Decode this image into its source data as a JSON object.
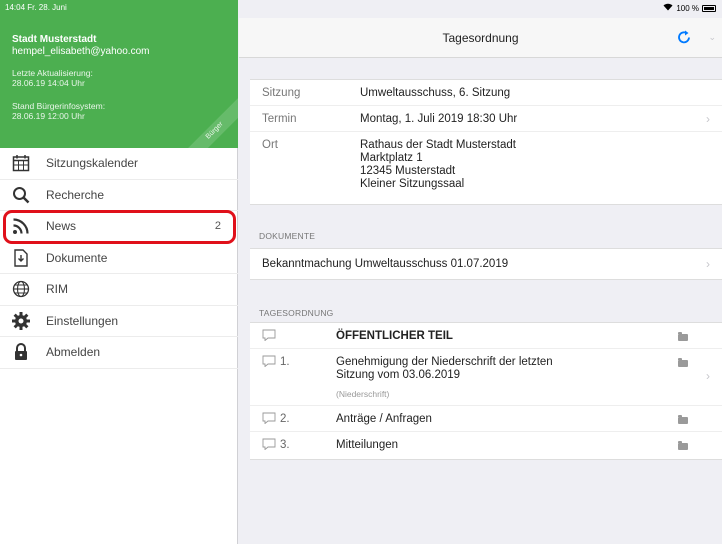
{
  "status_bar": {
    "time_date": "14:04  Fr. 28. Juni",
    "battery": "100 %"
  },
  "sidebar": {
    "city": "Stadt Musterstadt",
    "email": "hempel_elisabeth@yahoo.com",
    "last_update_label": "Letzte Aktualisierung:",
    "last_update_value": "28.06.19 14:04 Uhr",
    "system_label": "Stand Bürgerinfosystem:",
    "system_value": "28.06.19 12:00 Uhr",
    "ribbon": "Bürger",
    "items": [
      {
        "label": "Sitzungskalender",
        "icon": "calendar-icon",
        "count": ""
      },
      {
        "label": "Recherche",
        "icon": "search-icon",
        "count": ""
      },
      {
        "label": "News",
        "icon": "rss-icon",
        "count": "2"
      },
      {
        "label": "Dokumente",
        "icon": "document-icon",
        "count": ""
      },
      {
        "label": "RIM",
        "icon": "globe-icon",
        "count": ""
      },
      {
        "label": "Einstellungen",
        "icon": "gear-icon",
        "count": ""
      },
      {
        "label": "Abmelden",
        "icon": "lock-icon",
        "count": ""
      }
    ]
  },
  "nav": {
    "title": "Tagesordnung"
  },
  "meeting": {
    "sitzung_label": "Sitzung",
    "sitzung_value": "Umweltausschuss, 6. Sitzung",
    "termin_label": "Termin",
    "termin_value": "Montag, 1. Juli 2019 18:30 Uhr",
    "ort_label": "Ort",
    "ort_lines": [
      "Rathaus der Stadt Musterstadt",
      "Marktplatz 1",
      "12345 Musterstadt",
      "Kleiner Sitzungssaal"
    ]
  },
  "documents": {
    "section_label": "DOKUMENTE",
    "items": [
      {
        "label": "Bekanntmachung Umweltausschuss 01.07.2019"
      }
    ]
  },
  "agenda": {
    "section_label": "TAGESORDNUNG",
    "items": [
      {
        "number": "",
        "title": "ÖFFENTLICHER TEIL",
        "note": ""
      },
      {
        "number": "1.",
        "title_line1": "Genehmigung der Niederschrift der letzten",
        "title_line2": "Sitzung vom 03.06.2019",
        "note": "(Niederschrift)"
      },
      {
        "number": "2.",
        "title": "Anträge / Anfragen",
        "note": ""
      },
      {
        "number": "3.",
        "title": "Mitteilungen",
        "note": ""
      }
    ]
  },
  "colors": {
    "sidebar_header": "#4caf50",
    "accent": "#007aff",
    "highlight": "#e0101a"
  }
}
